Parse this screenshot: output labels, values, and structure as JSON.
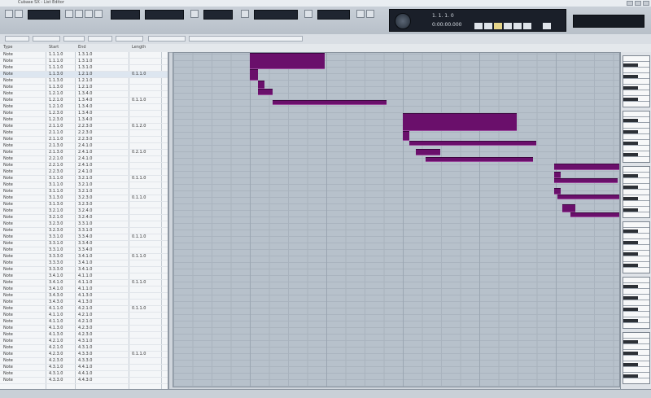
{
  "window": {
    "title": "Cubase SX - List Editor"
  },
  "toolbar": {
    "lcd_left": "",
    "lcd_mid": "",
    "lcd_right": ""
  },
  "transport": {
    "position_primary": "1. 1. 1.   0",
    "position_secondary": "0:00:00.000"
  },
  "meter_text": "",
  "subbar": {
    "items": [
      "",
      "",
      "",
      "",
      "",
      "",
      ""
    ]
  },
  "event_list": {
    "columns": [
      "Type",
      "Start",
      "End",
      "Length"
    ],
    "rows": [
      [
        "Note",
        "1.1.1.0",
        "1.3.1.0",
        ""
      ],
      [
        "Note",
        "1.1.1.0",
        "1.3.1.0",
        ""
      ],
      [
        "Note",
        "1.1.1.0",
        "1.3.1.0",
        ""
      ],
      [
        "Note",
        "1.1.3.0",
        "1.2.1.0",
        "0.1.1.0"
      ],
      [
        "Note",
        "1.1.3.0",
        "1.2.1.0",
        ""
      ],
      [
        "Note",
        "1.1.3.0",
        "1.2.1.0",
        ""
      ],
      [
        "Note",
        "1.2.1.0",
        "1.3.4.0",
        ""
      ],
      [
        "Note",
        "1.2.1.0",
        "1.3.4.0",
        "0.1.1.0"
      ],
      [
        "Note",
        "1.2.1.0",
        "1.3.4.0",
        ""
      ],
      [
        "Note",
        "1.2.3.0",
        "1.3.4.0",
        ""
      ],
      [
        "Note",
        "1.2.3.0",
        "1.3.4.0",
        ""
      ],
      [
        "Note",
        "2.1.1.0",
        "2.2.3.0",
        "0.1.2.0"
      ],
      [
        "Note",
        "2.1.1.0",
        "2.2.3.0",
        ""
      ],
      [
        "Note",
        "2.1.1.0",
        "2.2.3.0",
        ""
      ],
      [
        "Note",
        "2.1.3.0",
        "2.4.1.0",
        ""
      ],
      [
        "Note",
        "2.1.3.0",
        "2.4.1.0",
        "0.2.1.0"
      ],
      [
        "Note",
        "2.2.1.0",
        "2.4.1.0",
        ""
      ],
      [
        "Note",
        "2.2.1.0",
        "2.4.1.0",
        ""
      ],
      [
        "Note",
        "2.2.3.0",
        "2.4.1.0",
        ""
      ],
      [
        "Note",
        "3.1.1.0",
        "3.2.1.0",
        "0.1.1.0"
      ],
      [
        "Note",
        "3.1.1.0",
        "3.2.1.0",
        ""
      ],
      [
        "Note",
        "3.1.1.0",
        "3.2.1.0",
        ""
      ],
      [
        "Note",
        "3.1.3.0",
        "3.2.3.0",
        "0.1.1.0"
      ],
      [
        "Note",
        "3.1.3.0",
        "3.2.3.0",
        ""
      ],
      [
        "Note",
        "3.2.1.0",
        "3.2.4.0",
        ""
      ],
      [
        "Note",
        "3.2.1.0",
        "3.2.4.0",
        ""
      ],
      [
        "Note",
        "3.2.3.0",
        "3.3.1.0",
        ""
      ],
      [
        "Note",
        "3.2.3.0",
        "3.3.1.0",
        ""
      ],
      [
        "Note",
        "3.3.1.0",
        "3.3.4.0",
        "0.1.1.0"
      ],
      [
        "Note",
        "3.3.1.0",
        "3.3.4.0",
        ""
      ],
      [
        "Note",
        "3.3.1.0",
        "3.3.4.0",
        ""
      ],
      [
        "Note",
        "3.3.3.0",
        "3.4.1.0",
        "0.1.1.0"
      ],
      [
        "Note",
        "3.3.3.0",
        "3.4.1.0",
        ""
      ],
      [
        "Note",
        "3.3.3.0",
        "3.4.1.0",
        ""
      ],
      [
        "Note",
        "3.4.1.0",
        "4.1.1.0",
        ""
      ],
      [
        "Note",
        "3.4.1.0",
        "4.1.1.0",
        "0.1.1.0"
      ],
      [
        "Note",
        "3.4.1.0",
        "4.1.1.0",
        ""
      ],
      [
        "Note",
        "3.4.3.0",
        "4.1.3.0",
        ""
      ],
      [
        "Note",
        "3.4.3.0",
        "4.1.3.0",
        ""
      ],
      [
        "Note",
        "4.1.1.0",
        "4.2.1.0",
        "0.1.1.0"
      ],
      [
        "Note",
        "4.1.1.0",
        "4.2.1.0",
        ""
      ],
      [
        "Note",
        "4.1.1.0",
        "4.2.1.0",
        ""
      ],
      [
        "Note",
        "4.1.3.0",
        "4.2.3.0",
        ""
      ],
      [
        "Note",
        "4.1.3.0",
        "4.2.3.0",
        ""
      ],
      [
        "Note",
        "4.2.1.0",
        "4.3.1.0",
        ""
      ],
      [
        "Note",
        "4.2.1.0",
        "4.3.1.0",
        ""
      ],
      [
        "Note",
        "4.2.3.0",
        "4.3.3.0",
        "0.1.1.0"
      ],
      [
        "Note",
        "4.2.3.0",
        "4.3.3.0",
        ""
      ],
      [
        "Note",
        "4.3.1.0",
        "4.4.1.0",
        ""
      ],
      [
        "Note",
        "4.3.1.0",
        "4.4.1.0",
        ""
      ],
      [
        "Note",
        "4.3.3.0",
        "4.4.3.0",
        ""
      ]
    ]
  },
  "status": {
    "left": "",
    "right": ""
  },
  "colors": {
    "note": "#6a0f6b",
    "grid": "#b7c1cb"
  }
}
